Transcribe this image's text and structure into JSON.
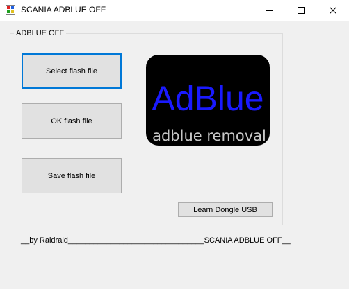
{
  "window": {
    "title": "SCANIA ADBLUE OFF",
    "icon": "app-icon"
  },
  "group": {
    "legend": "ADBLUE OFF"
  },
  "buttons": {
    "select": "Select flash file",
    "ok": "OK flash file",
    "save": "Save flash file",
    "dongle": "Learn Dongle USB"
  },
  "logo": {
    "title": "AdBlue",
    "subtitle": "adblue removal",
    "title_color": "#1a1aff",
    "subtitle_color": "#c8c8c8",
    "background": "#000000"
  },
  "footer": {
    "text": "__by Raidraid________________________________SCANIA ADBLUE OFF__"
  },
  "colors": {
    "focus_border": "#0078d7",
    "button_bg": "#e1e1e1",
    "window_bg": "#f0f0f0"
  }
}
